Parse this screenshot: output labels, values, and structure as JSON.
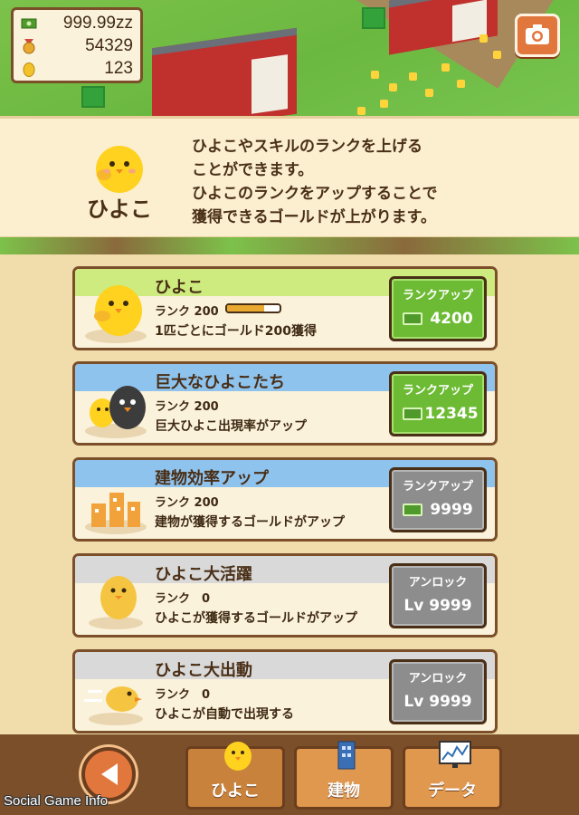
{
  "currency": {
    "money": "999.99zz",
    "medals": "54329",
    "eggs": "123"
  },
  "info": {
    "name": "ひよこ",
    "description": "ひよこやスキルのランクを上げる\nことができます。\nひよこのランクをアップすることで\n獲得できるゴールドが上がります。"
  },
  "cards": [
    {
      "title": "ひよこ",
      "rank": "ランク 200",
      "desc": "1匹ごとにゴールド200獲得",
      "button_label": "ランクアップ",
      "button_value": "4200",
      "progress": 0.7,
      "header_color": "#cdeb7e",
      "button_style": "green"
    },
    {
      "title": "巨大なひよこたち",
      "rank": "ランク 200",
      "desc": "巨大ひよこ出現率がアップ",
      "button_label": "ランクアップ",
      "button_value": "12345",
      "header_color": "#8ec3ee",
      "button_style": "green"
    },
    {
      "title": "建物効率アップ",
      "rank": "ランク 200",
      "desc": "建物が獲得するゴールドがアップ",
      "button_label": "ランクアップ",
      "button_value": "9999",
      "header_color": "#8ec3ee",
      "button_style": "gray"
    },
    {
      "title": "ひよこ大活躍",
      "rank": "ランク　0",
      "desc": "ひよこが獲得するゴールドがアップ",
      "button_label": "アンロック",
      "button_value": "Lv 9999",
      "header_color": "#d9d9d9",
      "button_style": "gray"
    },
    {
      "title": "ひよこ大出動",
      "rank": "ランク　0",
      "desc": "ひよこが自動で出現する",
      "button_label": "アンロック",
      "button_value": "Lv 9999",
      "header_color": "#d9d9d9",
      "button_style": "gray"
    }
  ],
  "tabs": [
    {
      "label": "ひよこ",
      "icon": "chick-icon"
    },
    {
      "label": "建物",
      "icon": "building-icon"
    },
    {
      "label": "データ",
      "icon": "chart-icon"
    }
  ],
  "watermark": "Social Game Info",
  "colors": {
    "accent": "#e2773d",
    "frame": "#7b4f2a",
    "panel": "#fbf2dc",
    "green_button": "#6dbb34",
    "gray_button": "#8d8d8d"
  }
}
